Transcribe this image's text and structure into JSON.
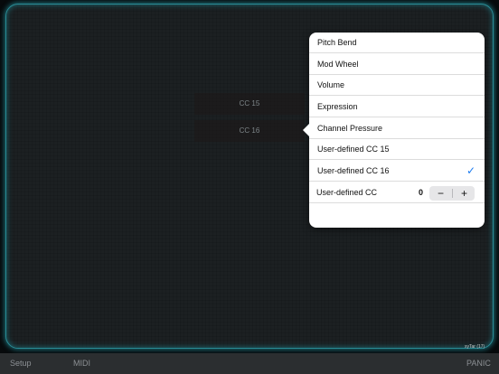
{
  "pad": {
    "cc_labels": [
      "CC 15",
      "CC 16"
    ]
  },
  "popover": {
    "items": [
      {
        "label": "Pitch Bend"
      },
      {
        "label": "Mod Wheel"
      },
      {
        "label": "Volume"
      },
      {
        "label": "Expression"
      },
      {
        "label": "Channel Pressure"
      },
      {
        "label": "User-defined CC 15"
      },
      {
        "label": "User-defined CC 16",
        "checked": true
      }
    ],
    "stepper": {
      "label": "User-defined CC",
      "value": "0",
      "minus": "−",
      "plus": "+"
    },
    "check_glyph": "✓",
    "accent_color": "#1b7bf0"
  },
  "version": "xyTar (17)",
  "bottom_bar": {
    "setup": "Setup",
    "midi": "MIDI",
    "panic": "PANIC"
  }
}
